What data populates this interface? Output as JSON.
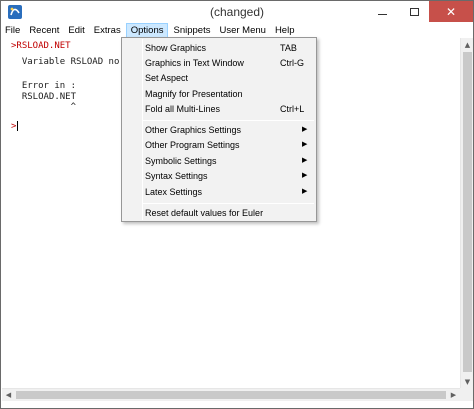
{
  "window": {
    "title": "(changed)",
    "controls": {
      "minimize": "minimize",
      "maximize": "maximize",
      "close": "✕"
    }
  },
  "menubar": {
    "items": [
      {
        "label": "File"
      },
      {
        "label": "Recent"
      },
      {
        "label": "Edit"
      },
      {
        "label": "Extras"
      },
      {
        "label": "Options",
        "active": true
      },
      {
        "label": "Snippets"
      },
      {
        "label": "User Menu"
      },
      {
        "label": "Help"
      }
    ]
  },
  "editor": {
    "lines": [
      ">RSLOAD.NET",
      "  Variable RSLOAD no",
      "",
      "  Error in :",
      "  RSLOAD.NET",
      "           ^",
      "",
      ">"
    ]
  },
  "options_menu": {
    "items": [
      {
        "label": "Show Graphics",
        "shortcut": "TAB"
      },
      {
        "label": "Graphics in Text Window",
        "shortcut": "Ctrl-G"
      },
      {
        "label": "Set Aspect",
        "shortcut": ""
      },
      {
        "label": "Magnify for Presentation",
        "shortcut": ""
      },
      {
        "label": "Fold all Multi-Lines",
        "shortcut": "Ctrl+L"
      }
    ],
    "submenus": [
      {
        "label": "Other Graphics Settings",
        "arrow": "▶"
      },
      {
        "label": "Other Program Settings",
        "arrow": "▶"
      },
      {
        "label": "Symbolic Settings",
        "arrow": "▶"
      },
      {
        "label": "Syntax Settings",
        "arrow": "▶"
      },
      {
        "label": "Latex Settings",
        "arrow": "▶"
      }
    ],
    "reset_label": "Reset default values for Euler"
  },
  "colors": {
    "menu_active_bg": "#cce8ff",
    "close_button": "#c7504a",
    "prompt_red": "#c00000"
  },
  "icons": {
    "app": "euler-app-icon",
    "scroll_up": "▲",
    "scroll_down": "▼",
    "scroll_left": "◀",
    "scroll_right": "▶"
  }
}
